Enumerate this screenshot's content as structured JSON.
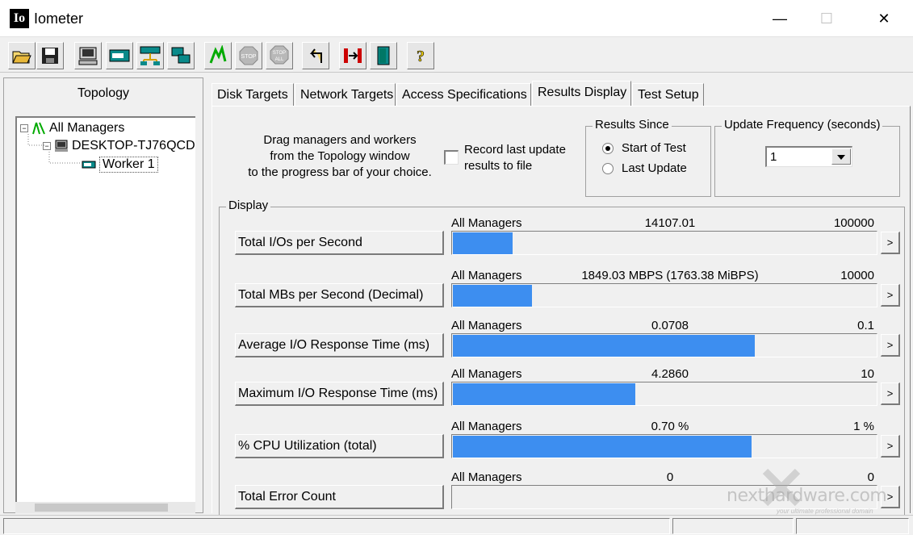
{
  "window": {
    "title": "Iometer",
    "app_icon_text": "Io"
  },
  "window_controls": {
    "minimize": "—",
    "maximize": "☐",
    "close": "✕"
  },
  "toolbar": {
    "buttons": [
      {
        "name": "open-config-button",
        "icon": "folder-open-icon"
      },
      {
        "name": "save-config-button",
        "icon": "floppy-disk-icon"
      },
      {
        "name": "start-new-manager-button",
        "icon": "computer-icon"
      },
      {
        "name": "start-disk-worker-button",
        "icon": "disk-drive-icon"
      },
      {
        "name": "start-network-worker-button",
        "icon": "network-icon"
      },
      {
        "name": "duplicate-worker-button",
        "icon": "duplicate-icon"
      },
      {
        "name": "start-tests-button",
        "icon": "green-flag-icon"
      },
      {
        "name": "stop-button",
        "icon": "stop-sign-icon"
      },
      {
        "name": "stop-all-button",
        "icon": "stop-all-icon"
      },
      {
        "name": "reset-workers-button",
        "icon": "reset-arrow-icon"
      },
      {
        "name": "exit-button",
        "icon": "exit-door-icon"
      },
      {
        "name": "about-button",
        "icon": "question-mark-icon"
      }
    ],
    "stop_text": "STOP",
    "stop_all_text": "ALL",
    "help_text": "?"
  },
  "topology": {
    "title": "Topology",
    "tree": [
      {
        "label": "All Managers",
        "icon": "all-managers-icon",
        "level": 0,
        "expander": "−"
      },
      {
        "label": "DESKTOP-TJ76QCD",
        "icon": "computer-icon",
        "level": 1,
        "expander": "−"
      },
      {
        "label": "Worker 1",
        "icon": "disk-worker-icon",
        "level": 2,
        "selected": true
      }
    ]
  },
  "tabs": [
    {
      "label": "Disk Targets",
      "active": false
    },
    {
      "label": "Network Targets",
      "active": false
    },
    {
      "label": "Access Specifications",
      "active": false
    },
    {
      "label": "Results Display",
      "active": true
    },
    {
      "label": "Test Setup",
      "active": false
    }
  ],
  "results_display": {
    "drag_text_lines": [
      "Drag managers and workers",
      "from the Topology window",
      "to the progress bar of your choice."
    ],
    "record_checkbox": {
      "lines": [
        "Record last update",
        "results to file"
      ],
      "checked": false
    },
    "results_since": {
      "title": "Results Since",
      "options": [
        {
          "label": "Start of Test",
          "checked": true
        },
        {
          "label": "Last Update",
          "checked": false
        }
      ]
    },
    "update_frequency": {
      "title": "Update Frequency (seconds)",
      "value": "1"
    },
    "display": {
      "title": "Display",
      "metrics": [
        {
          "label": "Total I/Os per Second",
          "manager": "All Managers",
          "value": "14107.01",
          "max": "100000",
          "fill_fraction": 0.141
        },
        {
          "label": "Total MBs per Second (Decimal)",
          "manager": "All Managers",
          "value": "1849.03 MBPS (1763.38 MiBPS)",
          "max": "10000",
          "fill_fraction": 0.185
        },
        {
          "label": "Average I/O Response Time (ms)",
          "manager": "All Managers",
          "value": "0.0708",
          "max": "0.1",
          "fill_fraction": 0.708
        },
        {
          "label": "Maximum I/O Response Time (ms)",
          "manager": "All Managers",
          "value": "4.2860",
          "max": "10",
          "fill_fraction": 0.4286
        },
        {
          "label": "% CPU Utilization (total)",
          "manager": "All Managers",
          "value": "0.70 %",
          "max": "1 %",
          "fill_fraction": 0.7
        },
        {
          "label": "Total Error Count",
          "manager": "All Managers",
          "value": "0",
          "max": "0",
          "fill_fraction": 0
        }
      ],
      "arrow_label": ">"
    }
  },
  "watermark": {
    "text": "nexthardware.com",
    "tagline": "your ultimate professional domain"
  },
  "colors": {
    "bar_fill": "#3d8ef0",
    "window_bg": "#f0f0f0"
  }
}
